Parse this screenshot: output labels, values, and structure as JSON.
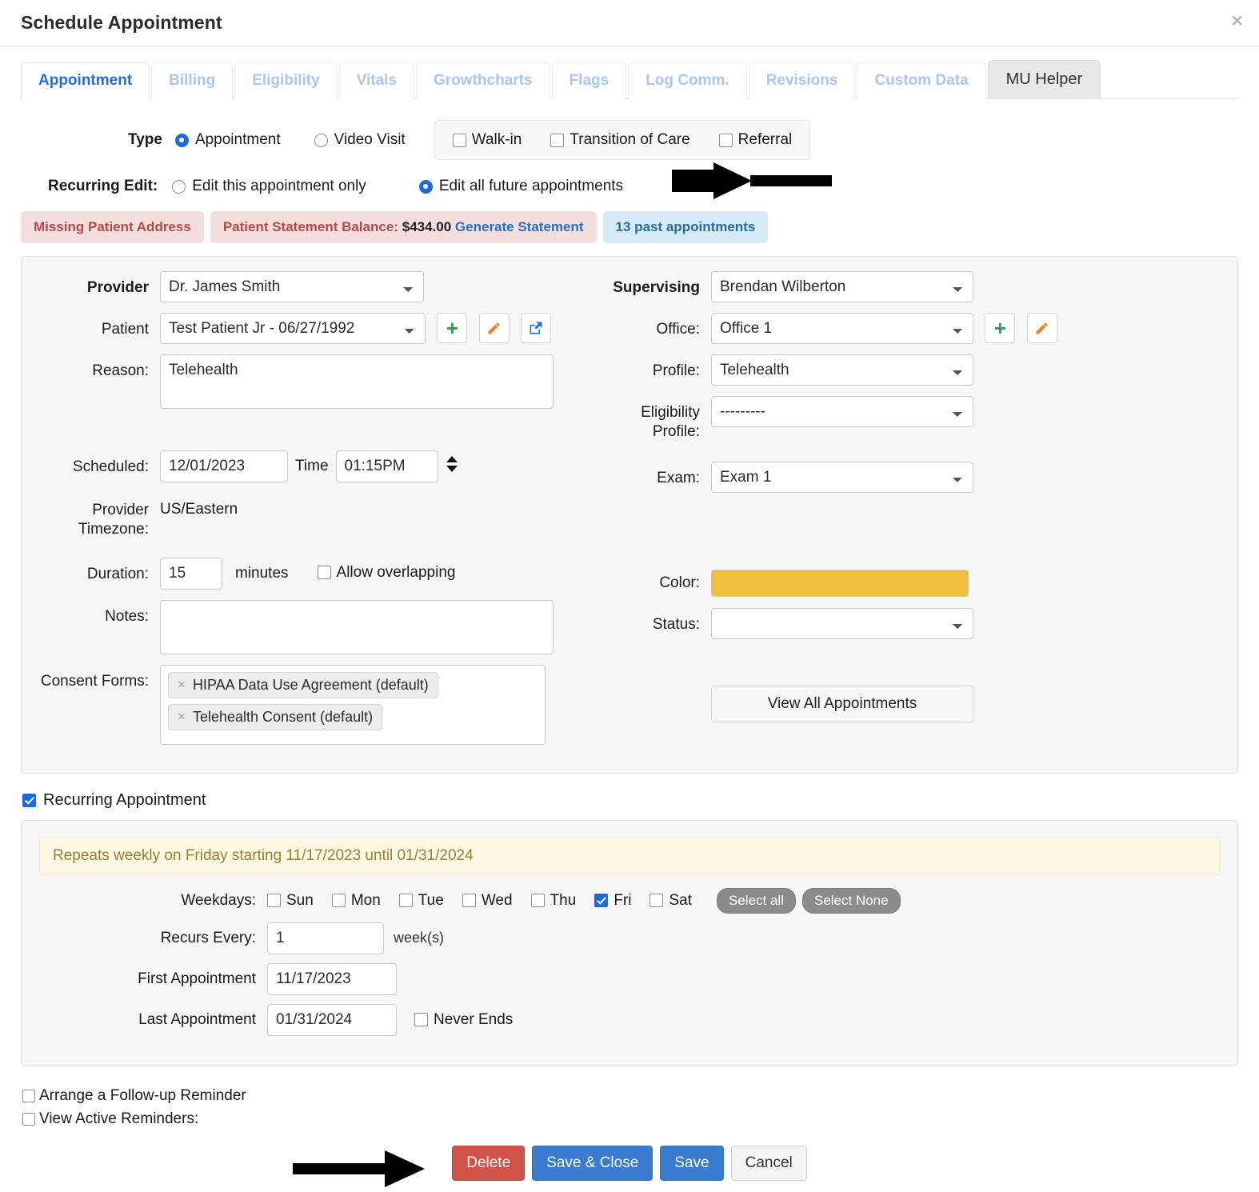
{
  "header": {
    "title": "Schedule Appointment",
    "close_icon": "close-icon"
  },
  "tabs": [
    {
      "label": "Appointment",
      "state": "active"
    },
    {
      "label": "Billing",
      "state": "normal"
    },
    {
      "label": "Eligibility",
      "state": "normal"
    },
    {
      "label": "Vitals",
      "state": "normal"
    },
    {
      "label": "Growthcharts",
      "state": "normal"
    },
    {
      "label": "Flags",
      "state": "normal"
    },
    {
      "label": "Log Comm.",
      "state": "normal"
    },
    {
      "label": "Revisions",
      "state": "normal"
    },
    {
      "label": "Custom Data",
      "state": "normal"
    },
    {
      "label": "MU Helper",
      "state": "selected"
    }
  ],
  "type_row": {
    "label": "Type",
    "radios": [
      {
        "label": "Appointment",
        "checked": true
      },
      {
        "label": "Video Visit",
        "checked": false
      }
    ],
    "checkboxes": [
      {
        "label": "Walk-in",
        "checked": false
      },
      {
        "label": "Transition of Care",
        "checked": false
      },
      {
        "label": "Referral",
        "checked": false
      }
    ]
  },
  "recurring_edit": {
    "label": "Recurring Edit:",
    "options": [
      {
        "label": "Edit this appointment only",
        "checked": false
      },
      {
        "label": "Edit all future appointments",
        "checked": true
      }
    ],
    "annotation": "arrow pointing at Edit all future appointments"
  },
  "badges": {
    "missing_address": "Missing Patient Address",
    "balance_label": "Patient Statement Balance:",
    "balance_amount": "$434.00",
    "generate_statement": "Generate Statement",
    "past_appointments": "13 past appointments"
  },
  "form": {
    "left": {
      "provider_label": "Provider",
      "provider_value": "Dr. James Smith",
      "patient_label": "Patient",
      "patient_value": "Test Patient Jr - 06/27/1992",
      "reason_label": "Reason:",
      "reason_value": "Telehealth",
      "scheduled_label": "Scheduled:",
      "scheduled_date": "12/01/2023",
      "time_label": "Time",
      "time_value": "01:15PM",
      "timezone_label": "Provider Timezone:",
      "timezone_value": "US/Eastern",
      "duration_label": "Duration:",
      "duration_value": "15",
      "minutes_label": "minutes",
      "allow_overlapping_label": "Allow overlapping",
      "allow_overlapping_checked": false,
      "notes_label": "Notes:",
      "notes_value": "",
      "consent_label": "Consent Forms:",
      "consent_forms": [
        "HIPAA Data Use Agreement (default)",
        "Telehealth Consent (default)"
      ]
    },
    "right": {
      "supervising_label": "Supervising",
      "supervising_value": "Brendan Wilberton",
      "office_label": "Office:",
      "office_value": "Office 1",
      "profile_label": "Profile:",
      "profile_value": "Telehealth",
      "eligibility_label": "Eligibility Profile:",
      "eligibility_value": "---------",
      "exam_label": "Exam:",
      "exam_value": "Exam 1",
      "color_label": "Color:",
      "color_value": "#efbe3c",
      "status_label": "Status:",
      "status_value": "",
      "view_all_label": "View All Appointments"
    }
  },
  "recurring": {
    "checkbox_label": "Recurring Appointment",
    "checked": true,
    "note": "Repeats weekly on Friday starting 11/17/2023 until 01/31/2024",
    "weekdays_label": "Weekdays:",
    "weekdays": [
      {
        "label": "Sun",
        "checked": false
      },
      {
        "label": "Mon",
        "checked": false
      },
      {
        "label": "Tue",
        "checked": false
      },
      {
        "label": "Wed",
        "checked": false
      },
      {
        "label": "Thu",
        "checked": false
      },
      {
        "label": "Fri",
        "checked": true
      },
      {
        "label": "Sat",
        "checked": false
      }
    ],
    "select_all_label": "Select all",
    "select_none_label": "Select None",
    "recurs_every_label": "Recurs Every:",
    "recurs_every_value": "1",
    "weeks_label": "week(s)",
    "first_appt_label": "First Appointment",
    "first_appt_value": "11/17/2023",
    "last_appt_label": "Last Appointment",
    "last_appt_value": "01/31/2024",
    "never_ends_label": "Never Ends",
    "never_ends_checked": false
  },
  "footer": {
    "follow_up_label": "Arrange a Follow-up Reminder",
    "follow_up_checked": false,
    "active_reminders_label": "View Active Reminders:",
    "active_reminders_checked": false,
    "buttons": {
      "delete": "Delete",
      "save_close": "Save & Close",
      "save": "Save",
      "cancel": "Cancel"
    },
    "annotation": "arrow pointing at Delete button"
  }
}
